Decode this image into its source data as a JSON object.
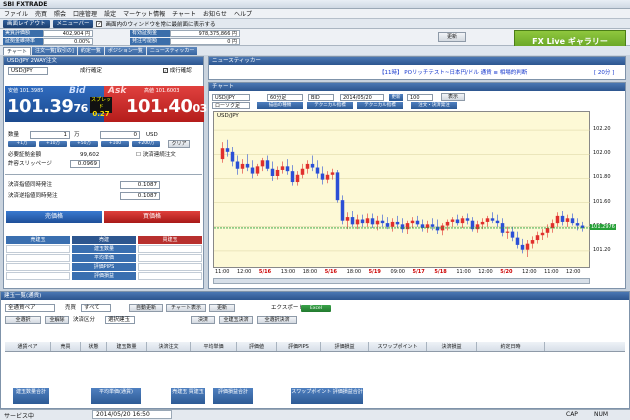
{
  "app": {
    "title": "SBI FXTRADE"
  },
  "menu": [
    "ファイル",
    "売買",
    "照会",
    "口座管理",
    "設定",
    "マーケット情報",
    "チャート",
    "お知らせ",
    "ヘルプ"
  ],
  "toolbar": {
    "layout": "画面レイアウト",
    "menu": "メニューバー",
    "checkbox": "画面内のウィンドウを常に最前面に表示する"
  },
  "account": {
    "cells": [
      {
        "label": "実質評価額",
        "value": "402,904 円"
      },
      {
        "label": "有効証拠金",
        "value": "404,900 円"
      },
      {
        "label": "必要証拠金",
        "value": "978,375,866 円"
      },
      {
        "label": "証拠金維持率",
        "value": "0.00%"
      },
      {
        "label": "発注可能額",
        "value": "0 円"
      }
    ],
    "update": "更新"
  },
  "gallery": "FX Live ギャラリー",
  "tabs": [
    "チャート",
    "注文一覧[取引の]",
    "約定一覧",
    "ポジション一覧",
    "ニュースティッカー"
  ],
  "order_panel": {
    "title": "USD/JPY 2WAY注文",
    "pair": "USD/JPY",
    "mode": "成行確定",
    "confirm": "成行確認",
    "bid": {
      "label": "安値",
      "low": "101.3985",
      "tag": "Bid",
      "price_main": "101.39",
      "price_sub": "76"
    },
    "ask": {
      "label": "高値",
      "high": "101.6003",
      "tag": "Ask",
      "price_main": "101.40",
      "price_sub": "03"
    },
    "spread": {
      "label": "スプレッド",
      "value": "0.27"
    },
    "qty_label": "数量",
    "qty_value": "1",
    "man": "万",
    "unit": "USD",
    "qty_value2": "0",
    "qty_btns": [
      "+1万",
      "+10万",
      "+50万",
      "+100",
      "+200万"
    ],
    "clear": "クリア",
    "margin_label": "必要証拠金額",
    "margin_value": "99,602",
    "slip_label": "許容スリッページ",
    "slip_value": "0.0969",
    "settle_label": "決済連続注文",
    "limit_label": "決済指値同時発注",
    "limit_value": "0.1087",
    "stop_label": "決済逆指値同時発注",
    "stop_value": "0.1087",
    "sell": "売価格",
    "buy": "買価格",
    "pos_headers": [
      "売建玉",
      "売建",
      "買建玉"
    ],
    "pos_rows": [
      "建玉数量",
      "平均単価",
      "評価PIPS",
      "評価損益"
    ]
  },
  "news": {
    "title": "ニュースティッカー",
    "item": "【11時】 POリッチテスト~日本円/ドル 通貨 ≡ 相場的判断",
    "next": "[ 20分 ]"
  },
  "chart": {
    "title": "チャート",
    "pair": "USD/JPY",
    "period": "60分足",
    "type": "BID",
    "date": "2014/05/20",
    "count": "100",
    "show_btn": "更新",
    "view": "表示",
    "type2": "ローソク足",
    "btns": [
      "描画の種類",
      "テクニカル指標",
      "テクニカル指標",
      "注文・決済発注"
    ],
    "symbol_label": "USD/JPY",
    "current": "101.2976",
    "chart_data": {
      "type": "candlestick",
      "yticks": [
        "102.20",
        "102.00",
        "101.80",
        "101.60",
        "101.40",
        "101.20"
      ],
      "xticks": [
        "11:00",
        "12:00",
        "5/16",
        "13:00",
        "18:00",
        "5/16",
        "18:00",
        "5/19",
        "09:00",
        "5/17",
        "5/18",
        "11:00",
        "12:00",
        "5/20",
        "12:00",
        "11:00",
        "12:00"
      ],
      "ylim": [
        101.1,
        102.3
      ],
      "hline": 101.39,
      "candles": [
        [
          101.96,
          102.1,
          101.93,
          102.05
        ],
        [
          102.05,
          102.12,
          101.98,
          102.02
        ],
        [
          102.02,
          102.06,
          101.9,
          101.94
        ],
        [
          101.94,
          101.99,
          101.83,
          101.88
        ],
        [
          101.88,
          101.96,
          101.84,
          101.92
        ],
        [
          101.92,
          102.0,
          101.86,
          101.89
        ],
        [
          101.89,
          101.95,
          101.8,
          101.84
        ],
        [
          101.84,
          101.92,
          101.82,
          101.9
        ],
        [
          101.9,
          101.97,
          101.86,
          101.95
        ],
        [
          101.95,
          101.99,
          101.86,
          101.88
        ],
        [
          101.88,
          101.94,
          101.78,
          101.82
        ],
        [
          101.82,
          101.9,
          101.79,
          101.87
        ],
        [
          101.87,
          101.94,
          101.84,
          101.9
        ],
        [
          101.9,
          101.96,
          101.83,
          101.86
        ],
        [
          101.86,
          101.91,
          101.74,
          101.77
        ],
        [
          101.77,
          101.86,
          101.74,
          101.83
        ],
        [
          101.83,
          101.92,
          101.8,
          101.88
        ],
        [
          101.88,
          101.95,
          101.84,
          101.92
        ],
        [
          101.92,
          101.99,
          101.86,
          101.89
        ],
        [
          101.89,
          101.95,
          101.8,
          101.84
        ],
        [
          101.84,
          101.9,
          101.75,
          101.79
        ],
        [
          101.79,
          101.86,
          101.76,
          101.83
        ],
        [
          101.83,
          101.88,
          101.79,
          101.85
        ],
        [
          101.85,
          101.87,
          101.6,
          101.62
        ],
        [
          101.62,
          101.66,
          101.42,
          101.45
        ],
        [
          101.45,
          101.52,
          101.38,
          101.48
        ],
        [
          101.48,
          101.53,
          101.4,
          101.42
        ],
        [
          101.42,
          101.5,
          101.38,
          101.46
        ],
        [
          101.46,
          101.5,
          101.4,
          101.43
        ],
        [
          101.43,
          101.51,
          101.4,
          101.47
        ],
        [
          101.47,
          101.51,
          101.39,
          101.42
        ],
        [
          101.42,
          101.49,
          101.37,
          101.45
        ],
        [
          101.45,
          101.5,
          101.4,
          101.43
        ],
        [
          101.43,
          101.48,
          101.38,
          101.4
        ],
        [
          101.4,
          101.47,
          101.36,
          101.44
        ],
        [
          101.44,
          101.49,
          101.39,
          101.42
        ],
        [
          101.42,
          101.47,
          101.35,
          101.38
        ],
        [
          101.38,
          101.45,
          101.34,
          101.43
        ],
        [
          101.43,
          101.48,
          101.39,
          101.45
        ],
        [
          101.45,
          101.49,
          101.4,
          101.42
        ],
        [
          101.42,
          101.46,
          101.36,
          101.39
        ],
        [
          101.39,
          101.45,
          101.35,
          101.42
        ],
        [
          101.42,
          101.47,
          101.37,
          101.4
        ],
        [
          101.4,
          101.46,
          101.34,
          101.37
        ],
        [
          101.37,
          101.43,
          101.33,
          101.41
        ],
        [
          101.41,
          101.46,
          101.37,
          101.44
        ],
        [
          101.44,
          101.48,
          101.4,
          101.46
        ],
        [
          101.46,
          101.5,
          101.41,
          101.43
        ],
        [
          101.43,
          101.49,
          101.39,
          101.47
        ],
        [
          101.47,
          101.51,
          101.42,
          101.45
        ],
        [
          101.45,
          101.48,
          101.36,
          101.38
        ],
        [
          101.38,
          101.45,
          101.35,
          101.42
        ],
        [
          101.42,
          101.47,
          101.38,
          101.44
        ],
        [
          101.44,
          101.49,
          101.4,
          101.47
        ],
        [
          101.47,
          101.52,
          101.43,
          101.45
        ],
        [
          101.45,
          101.5,
          101.4,
          101.43
        ],
        [
          101.43,
          101.47,
          101.32,
          101.35
        ],
        [
          101.35,
          101.4,
          101.3,
          101.36
        ],
        [
          101.36,
          101.4,
          101.28,
          101.31
        ],
        [
          101.31,
          101.36,
          101.22,
          101.25
        ],
        [
          101.25,
          101.3,
          101.18,
          101.21
        ],
        [
          101.21,
          101.29,
          101.15,
          101.26
        ],
        [
          101.26,
          101.32,
          101.22,
          101.29
        ],
        [
          101.29,
          101.36,
          101.26,
          101.33
        ],
        [
          101.33,
          101.38,
          101.29,
          101.35
        ],
        [
          101.35,
          101.42,
          101.31,
          101.39
        ],
        [
          101.39,
          101.46,
          101.35,
          101.43
        ],
        [
          101.43,
          101.52,
          101.4,
          101.49
        ],
        [
          101.49,
          101.53,
          101.41,
          101.44
        ],
        [
          101.44,
          101.5,
          101.4,
          101.47
        ],
        [
          101.47,
          101.51,
          101.41,
          101.43
        ],
        [
          101.43,
          101.47,
          101.37,
          101.41
        ],
        [
          101.41,
          101.44,
          101.36,
          101.39
        ]
      ]
    }
  },
  "positions": {
    "title": "建玉一覧(通貨)",
    "pair_filter": "全通貨ペア",
    "kind": "売買",
    "kind_value": "すべて",
    "btns": [
      "自動更新",
      "チャート表示",
      "更新",
      "Excel",
      "Excel"
    ],
    "excel_label": "エクスポート",
    "row2": [
      "全選択",
      "全解除",
      "決済区分",
      "選択建玉",
      "決済",
      "全建玉決済",
      "全選択決済"
    ],
    "headers": [
      "通貨ペア",
      "売買",
      "状態",
      "建玉数量",
      "決済注文",
      "平均単価",
      "評価値",
      "評価PIPS",
      "評価損益",
      "スワップポイント",
      "決済損益",
      "約定日時"
    ],
    "sum_btns": [
      "建玉数量合計",
      "平均単価(通貨)",
      "売建玉 買建玉",
      "評価損益合計",
      "スワップポイント 評価損益合計"
    ]
  },
  "status": {
    "text": "サービス中",
    "datetime": "2014/05/20 16:50",
    "caps": "CAP",
    "num": "NUM"
  }
}
